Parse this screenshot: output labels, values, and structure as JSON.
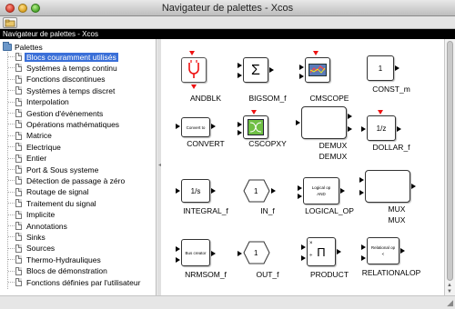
{
  "window": {
    "title": "Navigateur de palettes - Xcos"
  },
  "header": {
    "title": "Navigateur de palettes - Xcos"
  },
  "tree": {
    "root_label": "Palettes",
    "items": [
      {
        "label": "Blocs couramment utilisés",
        "selected": true
      },
      {
        "label": "Systèmes à temps continu"
      },
      {
        "label": "Fonctions discontinues"
      },
      {
        "label": "Systèmes à temps discret"
      },
      {
        "label": "Interpolation"
      },
      {
        "label": "Gestion d'évènements"
      },
      {
        "label": "Opérations mathématiques"
      },
      {
        "label": "Matrice"
      },
      {
        "label": "Electrique"
      },
      {
        "label": "Entier"
      },
      {
        "label": "Port & Sous systeme"
      },
      {
        "label": "Détection de passage à zéro"
      },
      {
        "label": "Routage de signal"
      },
      {
        "label": "Traitement du signal"
      },
      {
        "label": "Implicite"
      },
      {
        "label": "Annotations"
      },
      {
        "label": "Sinks"
      },
      {
        "label": "Sources"
      },
      {
        "label": "Thermo-Hydrauliques"
      },
      {
        "label": "Blocs de démonstration"
      },
      {
        "label": "Fonctions définies par l'utilisateur"
      }
    ]
  },
  "blocks": [
    {
      "name": "ANDBLK",
      "icon": "and-gate-icon"
    },
    {
      "name": "BIGSOM_f",
      "symbol": "Σ"
    },
    {
      "name": "CMSCOPE",
      "icon": "scope-icon"
    },
    {
      "name": "CONST_m",
      "symbol": "1"
    },
    {
      "name": "CONVERT",
      "symbol": "Convert to"
    },
    {
      "name": "CSCOPXY",
      "icon": "xy-scope-icon"
    },
    {
      "name": "DEMUX",
      "subtitle": "DEMUX"
    },
    {
      "name": "DOLLAR_f",
      "symbol": "1/z"
    },
    {
      "name": "INTEGRAL_f",
      "symbol": "1/s"
    },
    {
      "name": "IN_f",
      "symbol": "1"
    },
    {
      "name": "LOGICAL_OP",
      "symbol": "Logical op",
      "symbol2": "AND"
    },
    {
      "name": "MUX",
      "subtitle": "MUX"
    },
    {
      "name": "NRMSOM_f",
      "symbol": "Bus creator"
    },
    {
      "name": "OUT_f",
      "symbol": "1"
    },
    {
      "name": "PRODUCT",
      "symbol": "Π"
    },
    {
      "name": "RELATIONALOP",
      "symbol": "Relational op",
      "symbol2": "<"
    }
  ],
  "colors": {
    "selection": "#3a6fd8",
    "event_port": "#e11111",
    "header_bg": "#000000"
  }
}
